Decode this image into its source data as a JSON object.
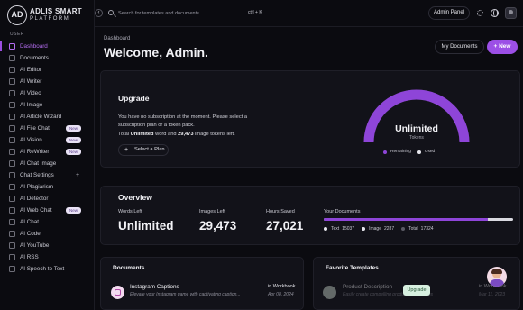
{
  "logo": {
    "mark": "AD",
    "line1": "ADLIS SMART",
    "line2": "PLATFORM"
  },
  "sidebar": {
    "section": "USER",
    "items": [
      {
        "label": "Dashboard",
        "active": true
      },
      {
        "label": "Documents"
      },
      {
        "label": "AI Editor"
      },
      {
        "label": "AI Writer"
      },
      {
        "label": "AI Video"
      },
      {
        "label": "AI Image"
      },
      {
        "label": "AI Article Wizard"
      },
      {
        "label": "AI File Chat",
        "badge": "New"
      },
      {
        "label": "AI Vision",
        "badge": "New"
      },
      {
        "label": "AI ReWriter",
        "badge": "New"
      },
      {
        "label": "AI Chat Image"
      },
      {
        "label": "Chat Settings",
        "plus": "+"
      },
      {
        "label": "AI Plagiarism"
      },
      {
        "label": "AI Detector"
      },
      {
        "label": "AI Web Chat",
        "badge": "New"
      },
      {
        "label": "AI Chat"
      },
      {
        "label": "AI Code"
      },
      {
        "label": "AI YouTube"
      },
      {
        "label": "AI RSS"
      },
      {
        "label": "AI Speech to Text"
      }
    ]
  },
  "topbar": {
    "collapse_glyph": "‹",
    "search_placeholder": "Search for templates and documents...",
    "shortcut": "ctrl + K",
    "admin_panel": "Admin Panel"
  },
  "header": {
    "breadcrumb": "Dashboard",
    "title": "Welcome, Admin.",
    "my_documents": "My Documents",
    "new_button": "+ New"
  },
  "upgrade": {
    "title": "Upgrade",
    "description": "You have no subscription at the moment. Please select a subscription plan or a token pack.",
    "tokens_prefix": "Total",
    "words": "Unlimited",
    "tokens_mid": "word and",
    "images": "29,473",
    "tokens_suffix": "image tokens left.",
    "plan_button": "Select a Plan",
    "plan_plus": "+",
    "gauge_value": "Unlimited",
    "gauge_label": "Tokens",
    "gauge_fraction_remaining": 1.0,
    "legend_remaining": "Remaining",
    "legend_used": "Used",
    "colors": {
      "remaining": "#8e45d8",
      "used": "#3a3a44",
      "accent": "#9c4fe6"
    }
  },
  "overview": {
    "title": "Overview",
    "stats": [
      {
        "label": "Words Left",
        "value": "Unlimited"
      },
      {
        "label": "Images Left",
        "value": "29,473"
      },
      {
        "label": "Hours Saved",
        "value": "27,021"
      }
    ],
    "your_documents": {
      "label": "Your Documents",
      "text_label": "Text",
      "text_value": "15037",
      "image_label": "Image",
      "image_value": "2287",
      "total_label": "Total",
      "total_value": "17324",
      "text_fraction": 0.868
    }
  },
  "documents": {
    "title": "Documents",
    "row": {
      "title": "Instagram Captions",
      "subtitle": "Elevate your Instagram game with captivating caption...",
      "location": "in Workbook",
      "date": "Apr 08, 2024"
    }
  },
  "favorites": {
    "title": "Favorite Templates",
    "row": {
      "title": "Product Description",
      "subtitle": "Easily create compelling product descriptions",
      "location": "in Workbook",
      "date": "Mar 11, 2023",
      "upgrade": "Upgrade"
    }
  }
}
